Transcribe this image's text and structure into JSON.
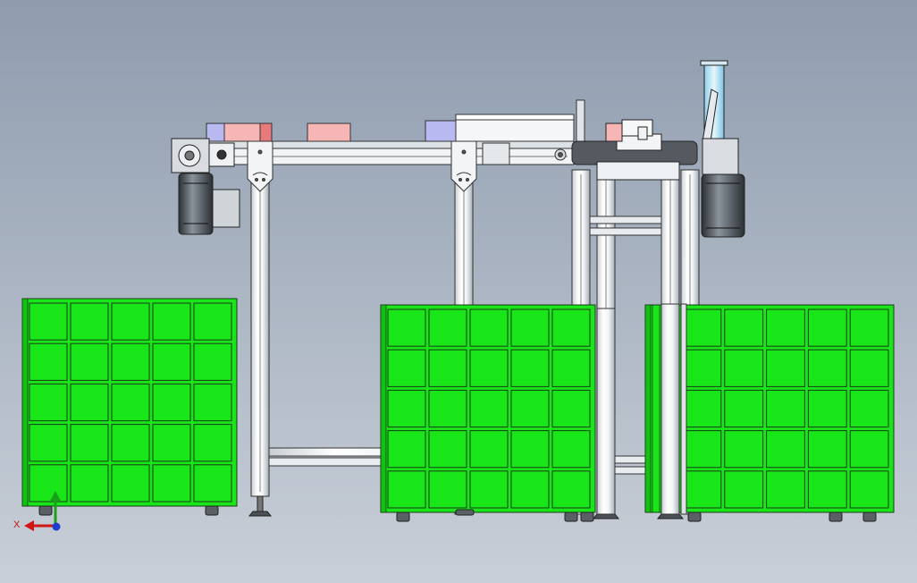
{
  "scene": {
    "type": "cad-assembly-front-view",
    "background_top": "#8e9cae",
    "background_bottom": "#c9cfd8"
  },
  "colors": {
    "bin_green": "#19e619",
    "bin_outline": "#1a3a1a",
    "aluminum": "#e8ecef",
    "aluminum_shade": "#9aa3ab",
    "motor_dark": "#3b4046",
    "part_blue": "#b9b9f2",
    "part_pink": "#f6b6b6",
    "part_red": "#e77b7b",
    "cylinder_cyan": "#a9dcf2",
    "outline": "#222222"
  },
  "triad": {
    "x_label": "X",
    "x_icon": "x-axis-arrow-icon",
    "y_icon": "y-axis-arrow-icon",
    "z_icon": "z-axis-dot-icon"
  },
  "bins": {
    "left": {
      "rows": 5,
      "cols": 5
    },
    "middle": {
      "rows": 5,
      "cols": 5
    },
    "right": {
      "rows": 5,
      "cols": 5
    }
  }
}
